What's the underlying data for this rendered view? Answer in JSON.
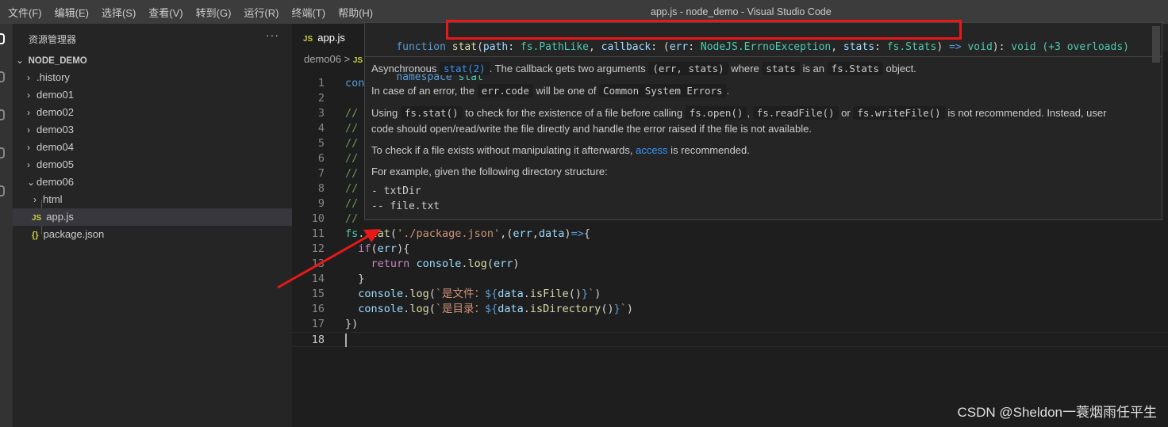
{
  "menubar": {
    "items": [
      "文件(F)",
      "编辑(E)",
      "选择(S)",
      "查看(V)",
      "转到(G)",
      "运行(R)",
      "终端(T)",
      "帮助(H)"
    ],
    "title": "app.js - node_demo - Visual Studio Code"
  },
  "sidebar": {
    "title": "资源管理器",
    "more": "···",
    "root": "NODE_DEMO",
    "items": [
      ".history",
      "demo01",
      "demo02",
      "demo03",
      "demo04",
      "demo05",
      "demo06",
      "html",
      "app.js",
      "package.json"
    ]
  },
  "tab": {
    "label": "app.js",
    "icon": "JS"
  },
  "breadcrumb": {
    "folder": "demo06",
    "sep": ">",
    "icon": "JS"
  },
  "code": {
    "lines": [
      {
        "n": "1",
        "text": "con"
      },
      {
        "n": "2",
        "text": ""
      },
      {
        "n": "3",
        "text": "//"
      },
      {
        "n": "4",
        "text": "//"
      },
      {
        "n": "5",
        "text": "//"
      },
      {
        "n": "6",
        "text": "//"
      },
      {
        "n": "7",
        "text": "//"
      },
      {
        "n": "8",
        "text": "//"
      },
      {
        "n": "9",
        "text": "//"
      },
      {
        "n": "10",
        "text": "//"
      },
      {
        "n": "11",
        "parts": [
          "fs",
          ".",
          "stat",
          "(",
          "'./package.json'",
          ",(",
          "err",
          ",",
          "data",
          ")",
          "=>",
          "{"
        ]
      },
      {
        "n": "12",
        "parts": [
          "if",
          "(",
          "err",
          "){"
        ]
      },
      {
        "n": "13",
        "parts": [
          "return",
          " ",
          "console",
          ".",
          "log",
          "(",
          "err",
          ")"
        ]
      },
      {
        "n": "14",
        "parts": [
          "}"
        ]
      },
      {
        "n": "15",
        "parts": [
          "console",
          ".",
          "log",
          "(",
          "`是文件：",
          "${",
          "data",
          ".",
          "isFile",
          "()",
          "}",
          "`",
          ")"
        ]
      },
      {
        "n": "16",
        "parts": [
          "console",
          ".",
          "log",
          "(",
          "`是目录：",
          "${",
          "data",
          ".",
          "isDirectory",
          "()",
          "}",
          "`",
          ")"
        ]
      },
      {
        "n": "17",
        "parts": [
          "})"
        ]
      },
      {
        "n": "18",
        "text": ""
      }
    ]
  },
  "hover": {
    "signature": [
      "function ",
      "stat",
      "(",
      "path",
      ": ",
      "fs.PathLike",
      ", ",
      "callback",
      ": (",
      "err",
      ": ",
      "NodeJS.ErrnoException",
      ", ",
      "stats",
      ": ",
      "fs.Stats",
      ") ",
      "=>",
      " ",
      "void",
      ")",
      ": ",
      "void",
      " (+3 overloads)"
    ],
    "namespace": [
      "namespace ",
      "stat"
    ],
    "p1": [
      "Asynchronous ",
      "stat(2)",
      ". The callback gets two arguments ",
      "(err, stats)",
      " where ",
      "stats",
      " is an ",
      "fs.Stats",
      " object."
    ],
    "p2": [
      "In case of an error, the ",
      "err.code",
      " will be one of ",
      "Common System Errors",
      "."
    ],
    "p3a": [
      "Using ",
      "fs.stat()",
      " to check for the existence of a file before calling ",
      "fs.open()",
      ", ",
      "fs.readFile()",
      " or ",
      "fs.writeFile()",
      " is not recommended. Instead, user"
    ],
    "p3b": "code should open/read/write the file directly and handle the error raised if the file is not available.",
    "p4": [
      "To check if a file exists without manipulating it afterwards, ",
      "access",
      " is recommended."
    ],
    "p5": "For example, given the following directory structure:",
    "pre": [
      "- txtDir",
      "-- file.txt"
    ]
  },
  "watermark": "CSDN @Sheldon一蓑烟雨任平生",
  "colors": {
    "annotation": "#e81818",
    "link": "#3794ff",
    "keyword": "#569cd6",
    "type": "#4ec9b0"
  }
}
